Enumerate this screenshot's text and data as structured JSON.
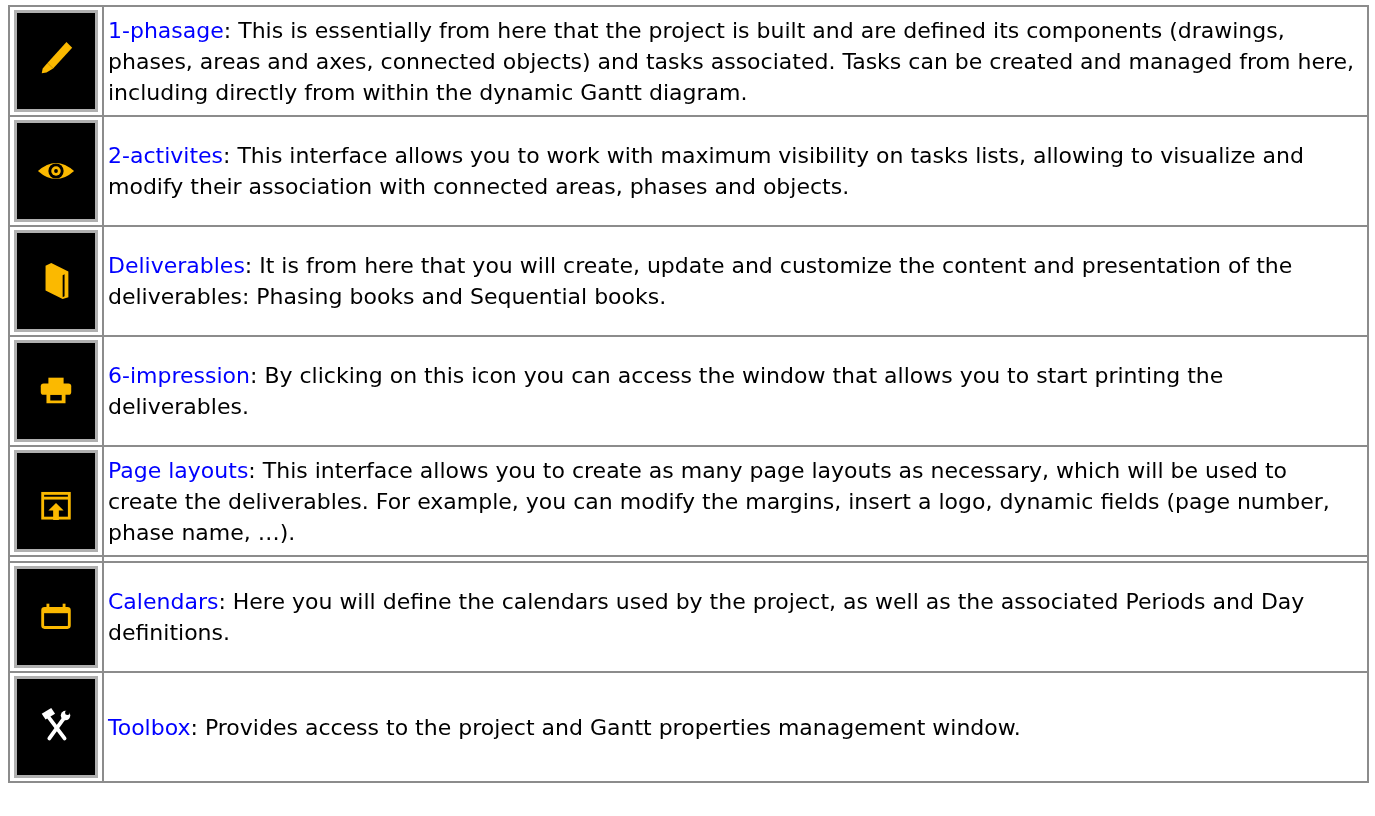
{
  "rows": [
    {
      "link": "1-phasage",
      "text": ": This is essentially from here that the project is built and are defined its components (drawings, phases, areas and axes, connected objects) and tasks associated. Tasks can be created and managed from here, including directly from within the dynamic Gantt diagram."
    },
    {
      "link": "2-activites",
      "text": ": This interface allows you to work with maximum visibility on tasks lists, allowing to visualize and modify their association with connected areas, phases and objects."
    },
    {
      "link": "Deliverables",
      "text": ": It is from here that you will create, update and customize the content and presentation of the deliverables: Phasing books and Sequential books."
    },
    {
      "link": "6-impression",
      "text": ": By clicking on this icon you can access the window that allows you to start printing the deliverables."
    },
    {
      "link": "Page layouts",
      "text": ": This interface allows you to create as many page layouts as necessary, which will be used to create the deliverables. For example, you can modify the margins, insert a logo, dynamic fields (page number, phase name, …)."
    },
    {
      "link": "Calendars",
      "text": ": Here you will define the calendars used by the project, as well as the associated Periods and Day definitions."
    },
    {
      "link": "Toolbox",
      "text": ": Provides access to the project and Gantt properties management window."
    }
  ]
}
